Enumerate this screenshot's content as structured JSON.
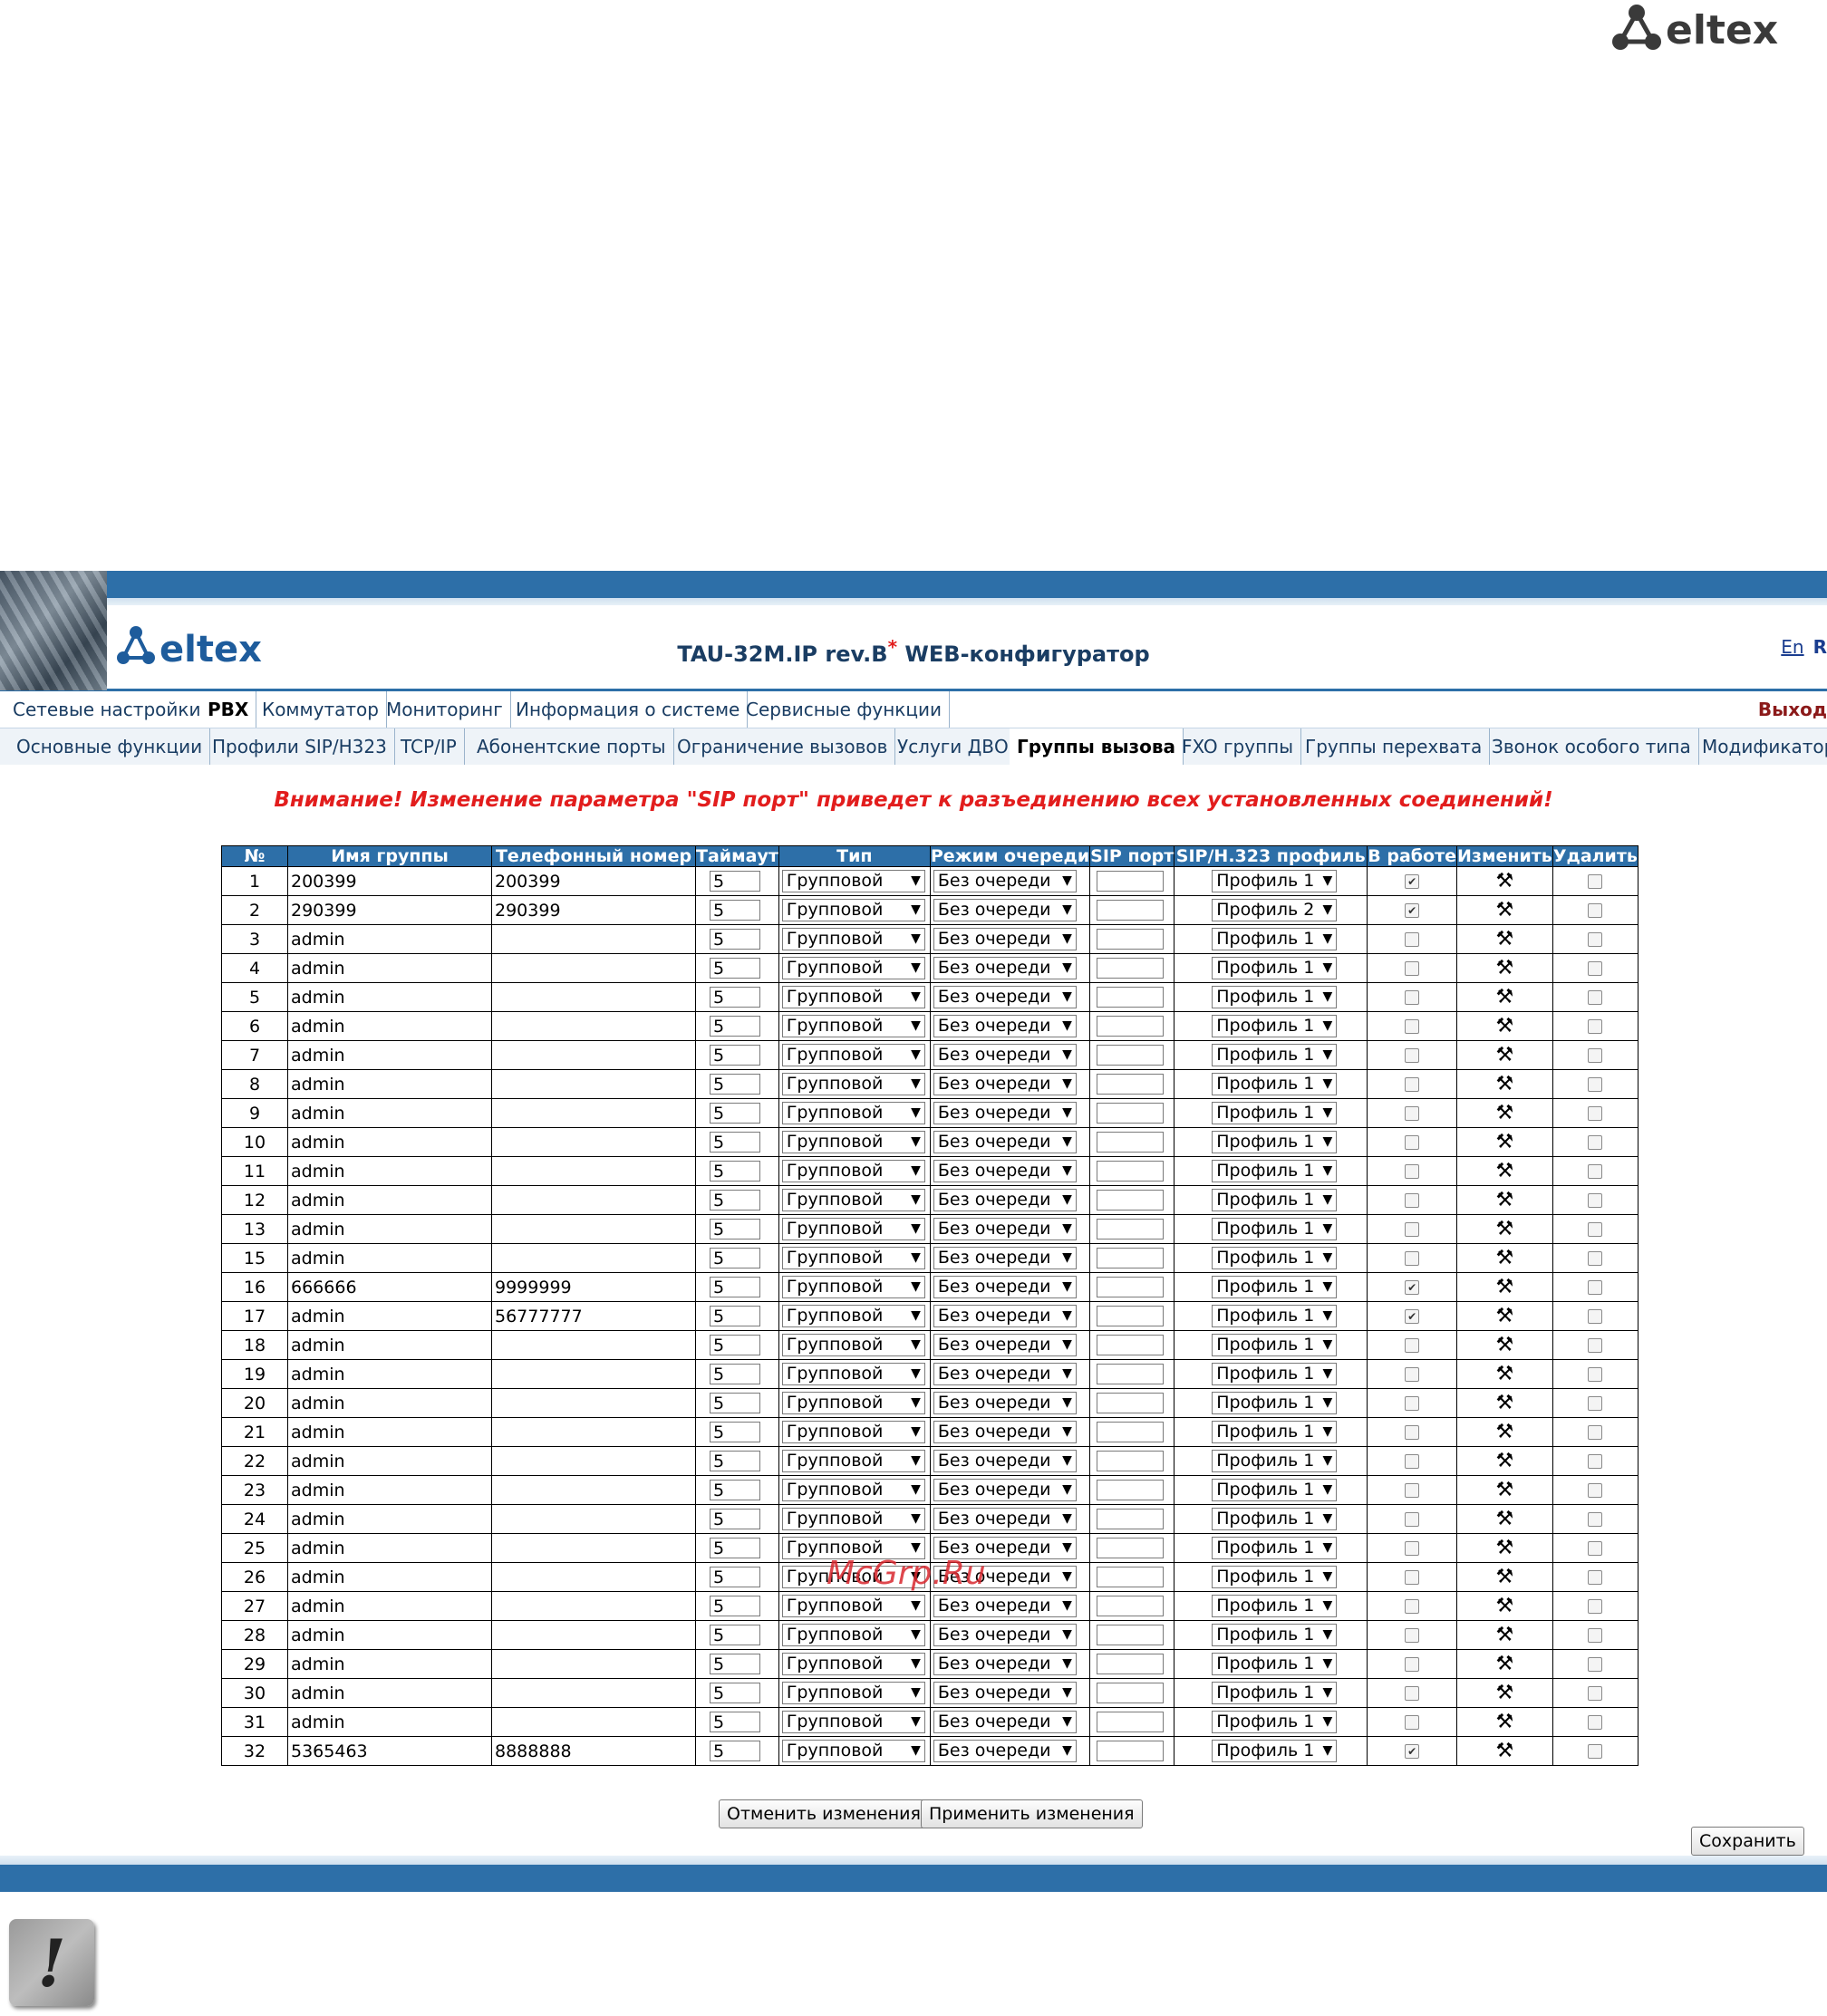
{
  "brand": {
    "logo_text": "eltex",
    "accent": "#2d6fa8",
    "warning_color": "#e21d1d"
  },
  "header": {
    "title": "TAU-32M.IP rev.B",
    "title_mark": "*",
    "title_suffix": " WEB-конфигуратор",
    "lang_en": "En",
    "lang_ru": "R"
  },
  "nav_main": {
    "items": [
      "Сетевые настройки",
      "PBX",
      "Коммутатор",
      "Мониторинг",
      "Информация о системе",
      "Сервисные функции"
    ],
    "active": "PBX",
    "exit": "Выход"
  },
  "nav_sub": {
    "items": [
      "Основные функции",
      "Профили SIP/H323",
      "TCP/IP",
      "Абонентские порты",
      "Ограничение вызовов",
      "Услуги ДВО",
      "Группы вызова",
      "FXO группы",
      "Группы перехвата",
      "Звонок особого типа",
      "Модификатор"
    ],
    "active": "Группы вызова"
  },
  "warning": "Внимание! Изменение параметра \"SIP порт\" приведет к разъединению всех установленных соединений!",
  "table": {
    "headers": [
      "№",
      "Имя группы",
      "Телефонный номер",
      "Таймаут",
      "Тип",
      "Режим очереди",
      "SIP порт",
      "SIP/H.323 профиль",
      "В работе",
      "Изменить",
      "Удалить"
    ],
    "rows": [
      {
        "no": "1",
        "name": "200399",
        "phone": "200399",
        "timeout": "5",
        "type": "Групповой",
        "queue": "Без очереди",
        "sip": "",
        "profile": "Профиль 1",
        "active": true
      },
      {
        "no": "2",
        "name": "290399",
        "phone": "290399",
        "timeout": "5",
        "type": "Групповой",
        "queue": "Без очереди",
        "sip": "",
        "profile": "Профиль 2",
        "active": true
      },
      {
        "no": "3",
        "name": "admin",
        "phone": "",
        "timeout": "5",
        "type": "Групповой",
        "queue": "Без очереди",
        "sip": "",
        "profile": "Профиль 1",
        "active": false
      },
      {
        "no": "4",
        "name": "admin",
        "phone": "",
        "timeout": "5",
        "type": "Групповой",
        "queue": "Без очереди",
        "sip": "",
        "profile": "Профиль 1",
        "active": false
      },
      {
        "no": "5",
        "name": "admin",
        "phone": "",
        "timeout": "5",
        "type": "Групповой",
        "queue": "Без очереди",
        "sip": "",
        "profile": "Профиль 1",
        "active": false
      },
      {
        "no": "6",
        "name": "admin",
        "phone": "",
        "timeout": "5",
        "type": "Групповой",
        "queue": "Без очереди",
        "sip": "",
        "profile": "Профиль 1",
        "active": false
      },
      {
        "no": "7",
        "name": "admin",
        "phone": "",
        "timeout": "5",
        "type": "Групповой",
        "queue": "Без очереди",
        "sip": "",
        "profile": "Профиль 1",
        "active": false
      },
      {
        "no": "8",
        "name": "admin",
        "phone": "",
        "timeout": "5",
        "type": "Групповой",
        "queue": "Без очереди",
        "sip": "",
        "profile": "Профиль 1",
        "active": false
      },
      {
        "no": "9",
        "name": "admin",
        "phone": "",
        "timeout": "5",
        "type": "Групповой",
        "queue": "Без очереди",
        "sip": "",
        "profile": "Профиль 1",
        "active": false
      },
      {
        "no": "10",
        "name": "admin",
        "phone": "",
        "timeout": "5",
        "type": "Групповой",
        "queue": "Без очереди",
        "sip": "",
        "profile": "Профиль 1",
        "active": false
      },
      {
        "no": "11",
        "name": "admin",
        "phone": "",
        "timeout": "5",
        "type": "Групповой",
        "queue": "Без очереди",
        "sip": "",
        "profile": "Профиль 1",
        "active": false
      },
      {
        "no": "12",
        "name": "admin",
        "phone": "",
        "timeout": "5",
        "type": "Групповой",
        "queue": "Без очереди",
        "sip": "",
        "profile": "Профиль 1",
        "active": false
      },
      {
        "no": "13",
        "name": "admin",
        "phone": "",
        "timeout": "5",
        "type": "Групповой",
        "queue": "Без очереди",
        "sip": "",
        "profile": "Профиль 1",
        "active": false
      },
      {
        "no": "15",
        "name": "admin",
        "phone": "",
        "timeout": "5",
        "type": "Групповой",
        "queue": "Без очереди",
        "sip": "",
        "profile": "Профиль 1",
        "active": false
      },
      {
        "no": "16",
        "name": "666666",
        "phone": "9999999",
        "timeout": "5",
        "type": "Групповой",
        "queue": "Без очереди",
        "sip": "",
        "profile": "Профиль 1",
        "active": true
      },
      {
        "no": "17",
        "name": "admin",
        "phone": "56777777",
        "timeout": "5",
        "type": "Групповой",
        "queue": "Без очереди",
        "sip": "",
        "profile": "Профиль 1",
        "active": true
      },
      {
        "no": "18",
        "name": "admin",
        "phone": "",
        "timeout": "5",
        "type": "Групповой",
        "queue": "Без очереди",
        "sip": "",
        "profile": "Профиль 1",
        "active": false
      },
      {
        "no": "19",
        "name": "admin",
        "phone": "",
        "timeout": "5",
        "type": "Групповой",
        "queue": "Без очереди",
        "sip": "",
        "profile": "Профиль 1",
        "active": false
      },
      {
        "no": "20",
        "name": "admin",
        "phone": "",
        "timeout": "5",
        "type": "Групповой",
        "queue": "Без очереди",
        "sip": "",
        "profile": "Профиль 1",
        "active": false
      },
      {
        "no": "21",
        "name": "admin",
        "phone": "",
        "timeout": "5",
        "type": "Групповой",
        "queue": "Без очереди",
        "sip": "",
        "profile": "Профиль 1",
        "active": false
      },
      {
        "no": "22",
        "name": "admin",
        "phone": "",
        "timeout": "5",
        "type": "Групповой",
        "queue": "Без очереди",
        "sip": "",
        "profile": "Профиль 1",
        "active": false
      },
      {
        "no": "23",
        "name": "admin",
        "phone": "",
        "timeout": "5",
        "type": "Групповой",
        "queue": "Без очереди",
        "sip": "",
        "profile": "Профиль 1",
        "active": false
      },
      {
        "no": "24",
        "name": "admin",
        "phone": "",
        "timeout": "5",
        "type": "Групповой",
        "queue": "Без очереди",
        "sip": "",
        "profile": "Профиль 1",
        "active": false
      },
      {
        "no": "25",
        "name": "admin",
        "phone": "",
        "timeout": "5",
        "type": "Групповой",
        "queue": "Без очереди",
        "sip": "",
        "profile": "Профиль 1",
        "active": false
      },
      {
        "no": "26",
        "name": "admin",
        "phone": "",
        "timeout": "5",
        "type": "Групповой",
        "queue": "Без очереди",
        "sip": "",
        "profile": "Профиль 1",
        "active": false
      },
      {
        "no": "27",
        "name": "admin",
        "phone": "",
        "timeout": "5",
        "type": "Групповой",
        "queue": "Без очереди",
        "sip": "",
        "profile": "Профиль 1",
        "active": false
      },
      {
        "no": "28",
        "name": "admin",
        "phone": "",
        "timeout": "5",
        "type": "Групповой",
        "queue": "Без очереди",
        "sip": "",
        "profile": "Профиль 1",
        "active": false
      },
      {
        "no": "29",
        "name": "admin",
        "phone": "",
        "timeout": "5",
        "type": "Групповой",
        "queue": "Без очереди",
        "sip": "",
        "profile": "Профиль 1",
        "active": false
      },
      {
        "no": "30",
        "name": "admin",
        "phone": "",
        "timeout": "5",
        "type": "Групповой",
        "queue": "Без очереди",
        "sip": "",
        "profile": "Профиль 1",
        "active": false
      },
      {
        "no": "31",
        "name": "admin",
        "phone": "",
        "timeout": "5",
        "type": "Групповой",
        "queue": "Без очереди",
        "sip": "",
        "profile": "Профиль 1",
        "active": false
      },
      {
        "no": "32",
        "name": "5365463",
        "phone": "8888888",
        "timeout": "5",
        "type": "Групповой",
        "queue": "Без очереди",
        "sip": "",
        "profile": "Профиль 1",
        "active": true
      }
    ]
  },
  "buttons": {
    "cancel": "Отменить изменения",
    "apply": "Применить изменения",
    "save": "Сохранить"
  },
  "watermark": "McGrp.Ru",
  "icons": {
    "edit": "tools-icon",
    "note": "exclamation-icon"
  }
}
